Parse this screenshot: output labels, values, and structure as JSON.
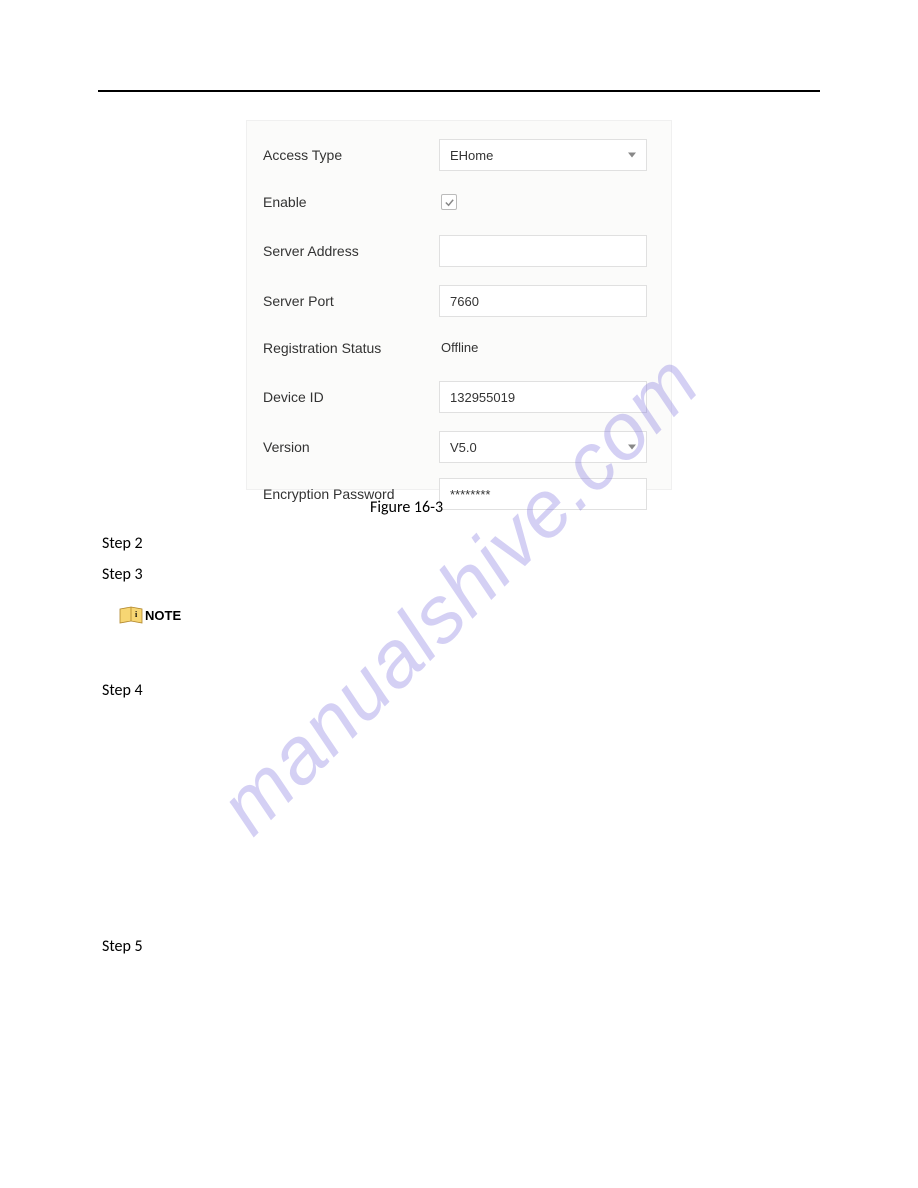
{
  "form": {
    "access_type": {
      "label": "Access Type",
      "value": "EHome"
    },
    "enable": {
      "label": "Enable",
      "checked": true
    },
    "server_address": {
      "label": "Server Address",
      "value": ""
    },
    "server_port": {
      "label": "Server Port",
      "value": "7660"
    },
    "registration_status": {
      "label": "Registration Status",
      "value": "Offline"
    },
    "device_id": {
      "label": "Device ID",
      "value": "132955019"
    },
    "version": {
      "label": "Version",
      "value": "V5.0"
    },
    "encryption_password": {
      "label": "Encryption Password",
      "value": "********"
    }
  },
  "caption": "Figure 16-3",
  "steps": {
    "s2": "Step 2",
    "s3": "Step 3",
    "s4": "Step 4",
    "s5": "Step 5"
  },
  "note_label": "NOTE",
  "watermark": "manualshive.com"
}
